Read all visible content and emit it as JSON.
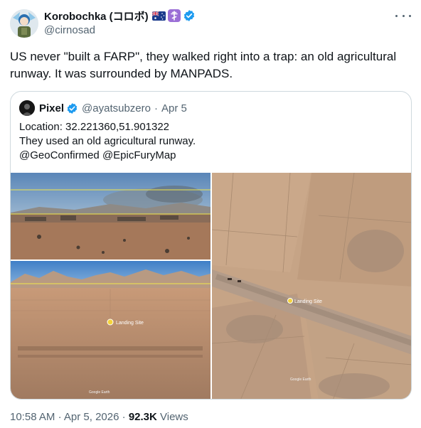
{
  "author": {
    "display_name": "Korobochka (コロボ)",
    "handle": "@cirnosad",
    "flag_icon": "australia-flag-icon",
    "badge_icon": "orthodox-cross-icon",
    "verified_color": "#1d9bf0"
  },
  "tweet": {
    "lines": [
      "US never \"built a FARP\", they walked right into a trap: an old agricultural",
      "runway. It was surrounded by MANPADS."
    ]
  },
  "quoted": {
    "display_name": "Pixel",
    "handle": "@ayatsubzero",
    "separator": "·",
    "date": "Apr 5",
    "lines": [
      "Location: 32.221360,51.901322",
      "They used an old agricultural runway.",
      "@GeoConfirmed @EpicFuryMap"
    ],
    "media_labels": {
      "landing_site": "Landing Site",
      "source_credit": "Google Earth"
    }
  },
  "footer": {
    "time": "10:58 AM",
    "separator": "·",
    "date": "Apr 5, 2026",
    "views_count": "92.3K",
    "views_label": "Views"
  },
  "colors": {
    "accent": "#1d9bf0",
    "text": "#0f1419",
    "secondary": "#536471",
    "border": "#cfd9de"
  }
}
